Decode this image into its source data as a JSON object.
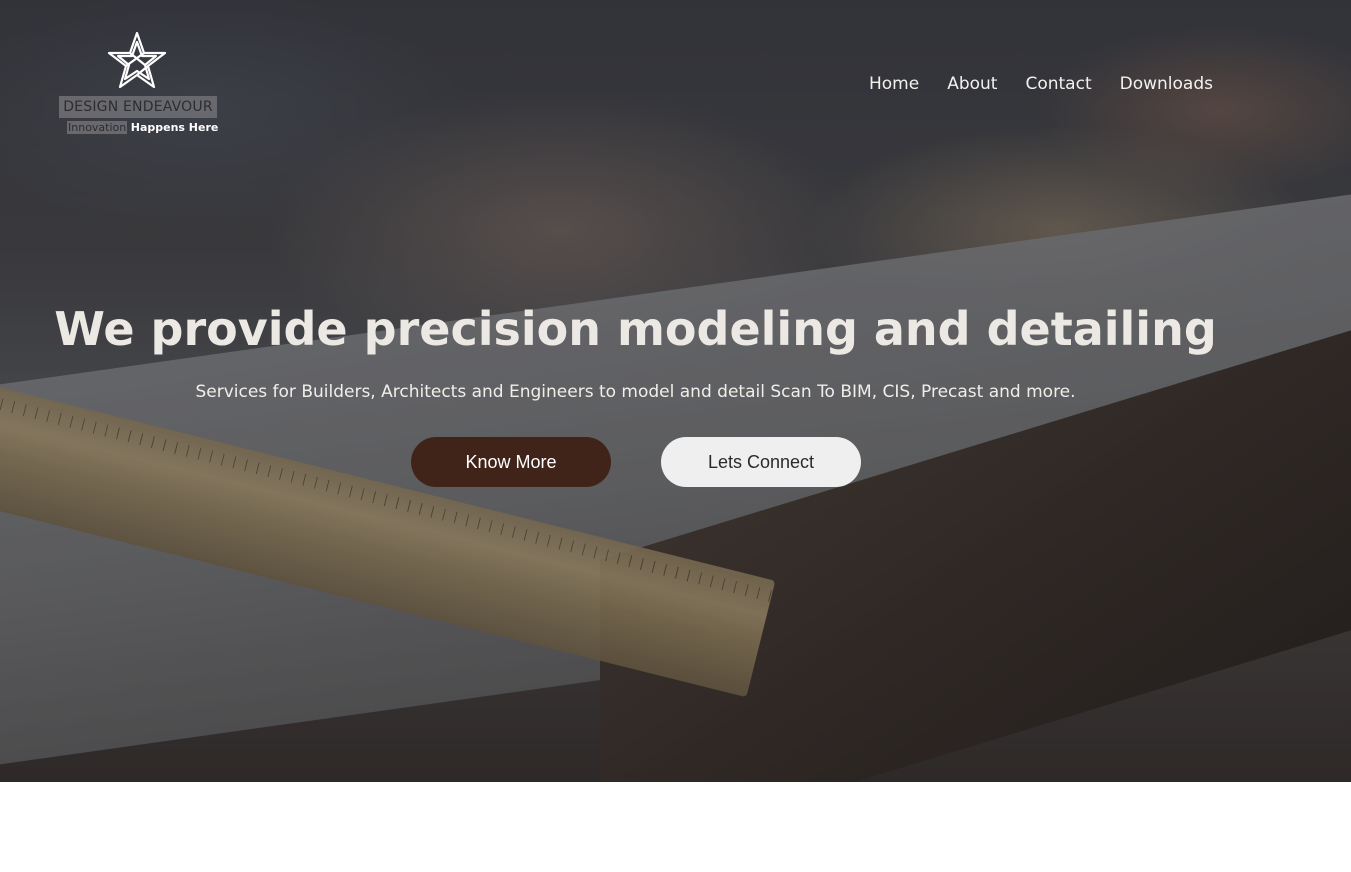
{
  "brand": {
    "name": "DESIGN ENDEAVOUR",
    "tagline_highlight": "Innovation",
    "tagline_rest": "Happens Here",
    "logo_icon": "star-knot-icon"
  },
  "nav": {
    "items": [
      {
        "label": "Home"
      },
      {
        "label": "About"
      },
      {
        "label": "Contact"
      },
      {
        "label": "Downloads"
      }
    ]
  },
  "hero": {
    "headline": "We provide precision modeling and detailing",
    "subline": "Services for Builders, Architects and Engineers to model and detail Scan To BIM, CIS, Precast and more.",
    "primary_button": "Know More",
    "secondary_button": "Lets Connect",
    "background_image": "drafting-table-photo"
  },
  "colors": {
    "primary_button_bg": "#40241a",
    "secondary_button_bg": "#efefef",
    "headline_text": "#ece8e4"
  }
}
